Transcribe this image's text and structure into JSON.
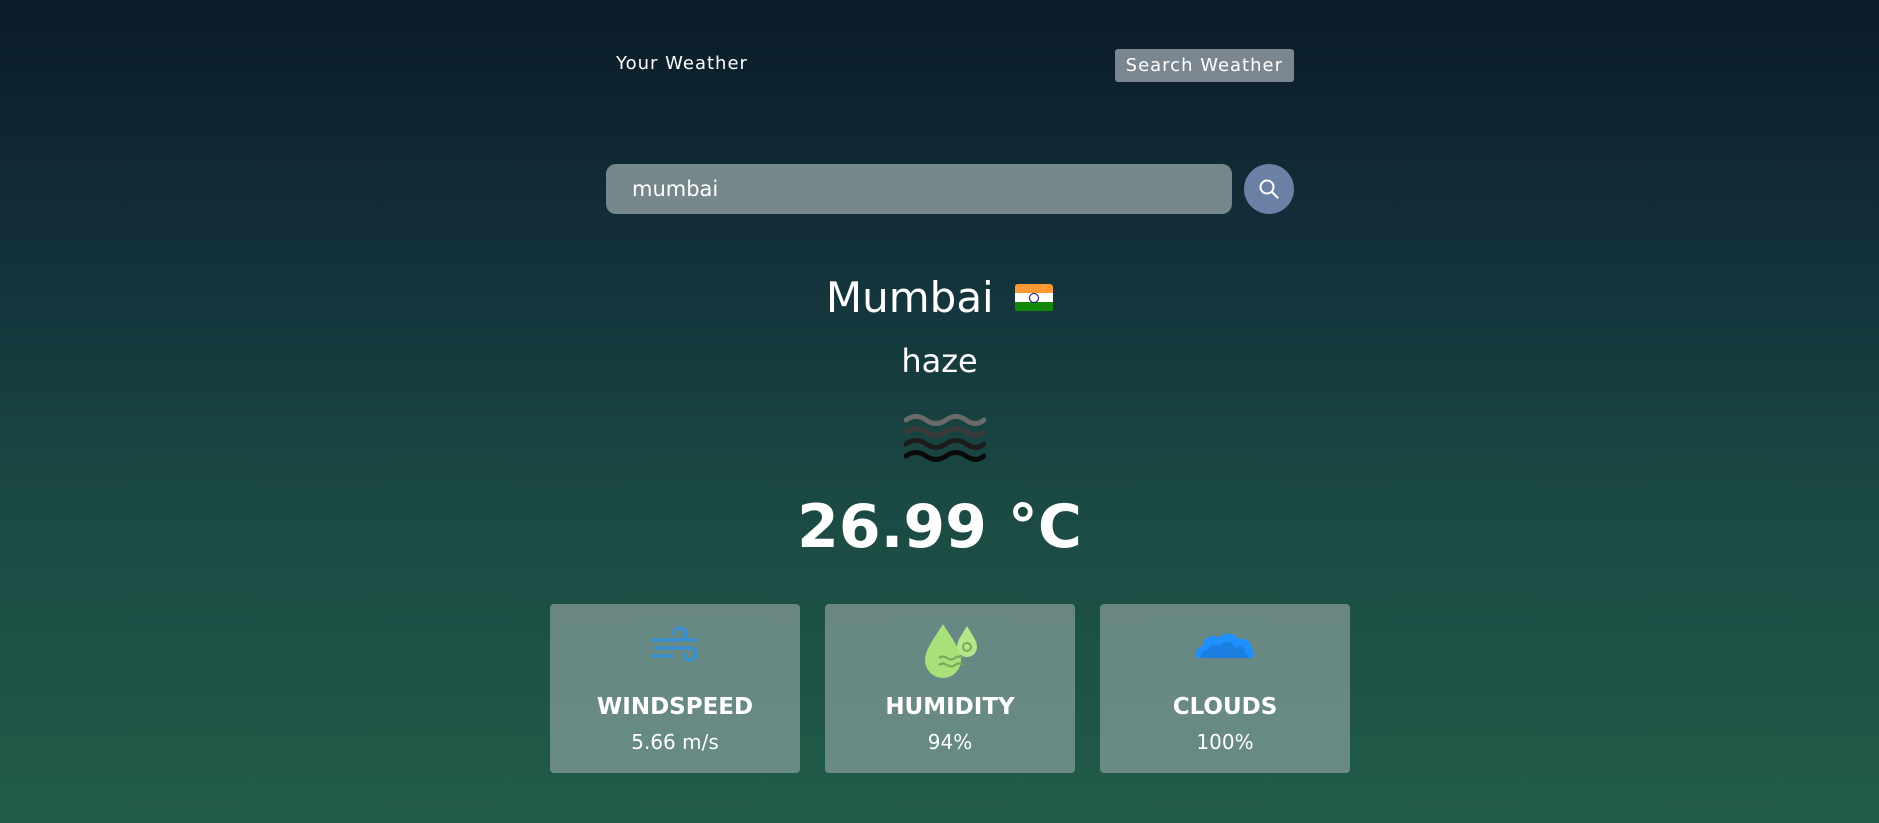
{
  "nav": {
    "your_weather_label": "Your Weather",
    "search_weather_label": "Search Weather"
  },
  "search": {
    "value": "mumbai",
    "button_icon": "search-icon"
  },
  "weather": {
    "city": "Mumbai",
    "country_flag": "india-flag-icon",
    "description": "haze",
    "condition_icon": "haze-icon",
    "temperature": "26.99 °C"
  },
  "stats": [
    {
      "icon": "wind-icon",
      "label": "WINDSPEED",
      "value": "5.66 m/s"
    },
    {
      "icon": "humidity-icon",
      "label": "HUMIDITY",
      "value": "94%"
    },
    {
      "icon": "clouds-icon",
      "label": "CLOUDS",
      "value": "100%"
    }
  ],
  "colors": {
    "tab_active_bg": "#7a8690",
    "input_bg": "#75878a",
    "search_button_bg": "#6981a4",
    "wind_icon": "#2f8fd8",
    "humidity_icon": "#a8e07a",
    "clouds_icon": "#1e90ff"
  }
}
